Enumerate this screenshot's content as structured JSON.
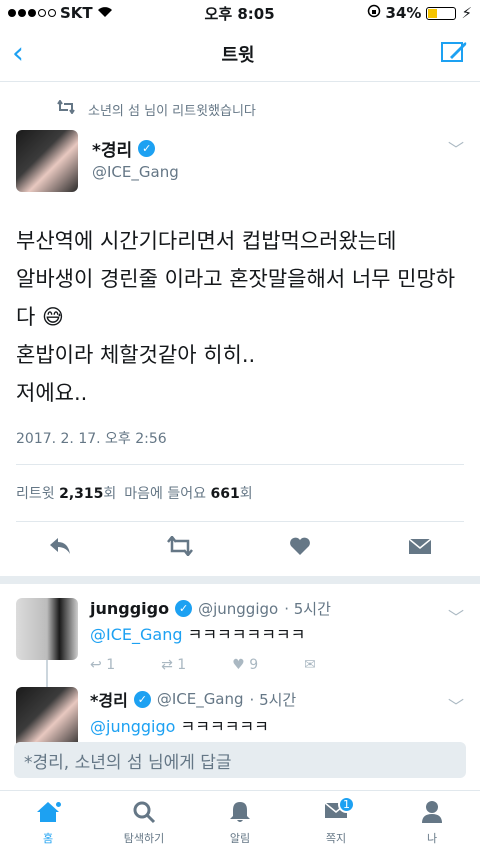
{
  "status_bar": {
    "carrier": "SKT",
    "time": "오후 8:05",
    "battery": "34%"
  },
  "nav": {
    "title": "트윗"
  },
  "retweet_context": {
    "text": "소년의 섬 님이 리트윗했습니다"
  },
  "tweet": {
    "display_name": "*경리",
    "handle": "@ICE_Gang",
    "text": "부산역에 시간기다리면서 컵밥먹으러왔는데\n알바생이 경린줄 이라고 혼잣말을해서 너무 민망하다 😅\n혼밥이라 체할것같아 히히..\n저에요..",
    "date": "2017. 2. 17. 오후 2:56",
    "retweets_label": "리트윗",
    "retweets": "2,315",
    "retweets_unit": "회",
    "likes_label": "마음에 들어요",
    "likes": "661",
    "likes_unit": "회"
  },
  "replies": [
    {
      "name": "junggigo",
      "handle": "@junggigo",
      "time": "· 5시간",
      "mention": "@ICE_Gang",
      "text": "ㅋㅋㅋㅋㅋㅋㅋㅋ",
      "reply_count": "1",
      "retweet_count": "1",
      "like_count": "9"
    },
    {
      "name": "*경리",
      "handle": "@ICE_Gang",
      "time": "· 5시간",
      "mention": "@junggigo",
      "text": "ㅋㅋㅋㅋㅋㅋ"
    }
  ],
  "reply_box": {
    "placeholder": "*경리, 소년의 섬 님에게 답글"
  },
  "tabbar": {
    "home": "홈",
    "search": "탐색하기",
    "notifications": "알림",
    "messages": "쪽지",
    "messages_badge": "1",
    "me": "나"
  },
  "colors": {
    "accent": "#1da1f2"
  }
}
